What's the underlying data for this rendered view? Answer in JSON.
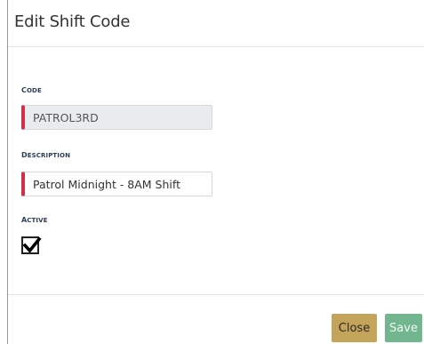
{
  "dialog": {
    "title": "Edit Shift Code"
  },
  "form": {
    "code": {
      "label_first": "C",
      "label_rest": "ODE",
      "value": "PATROL3RD"
    },
    "description": {
      "label_first": "D",
      "label_rest": "ESCRIPTION",
      "value": "Patrol Midnight - 8AM Shift"
    },
    "active": {
      "label_first": "A",
      "label_rest": "CTIVE",
      "checked": true
    }
  },
  "footer": {
    "close_label": "Close",
    "save_label": "Save"
  },
  "colors": {
    "required_accent": "#d0314a",
    "close_button": "#c4a35a",
    "save_button": "#72b68f",
    "label_text": "#2c3e57"
  }
}
